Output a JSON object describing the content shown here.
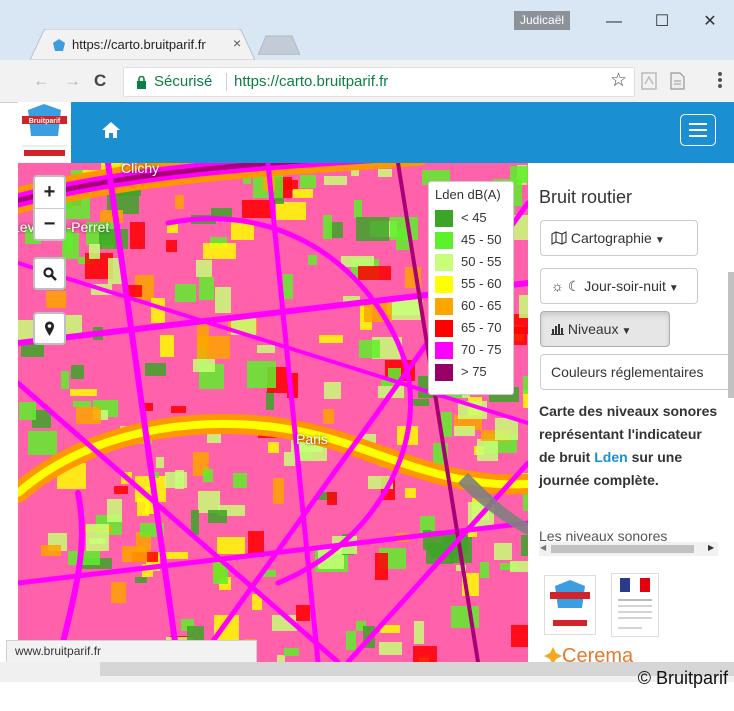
{
  "browser": {
    "tab_title": "https://carto.bruitparif.fr",
    "tab_close": "×",
    "user_name": "Judicaël",
    "window_controls": {
      "minimize": "—",
      "maximize": "☐",
      "close": "✕"
    },
    "nav": {
      "back": "←",
      "forward": "→",
      "reload": "C"
    },
    "address": {
      "secure_label": "Sécurisé",
      "url": "https://carto.bruitparif.fr"
    },
    "bookmark_star": "☆",
    "status_url": "www.bruitparif.fr"
  },
  "colors": {
    "header_blue": "#1a90d3",
    "chrome_tabstrip": "#d9e6f3",
    "secure_green": "#0b8043"
  },
  "map": {
    "controls": {
      "zoom_in": "+",
      "zoom_out": "−",
      "search_icon": "search-icon",
      "locate_icon": "map-marker-icon"
    },
    "place_labels": {
      "clichy": "Clichy",
      "levallois": "Levallois-Perret",
      "paris": "Paris"
    },
    "legend": {
      "title": "Lden dB(A)",
      "rows": [
        {
          "label": "< 45",
          "color": "#3ca528"
        },
        {
          "label": "45 - 50",
          "color": "#5ef02c"
        },
        {
          "label": "50 - 55",
          "color": "#c8ff78"
        },
        {
          "label": "55 - 60",
          "color": "#ffff00"
        },
        {
          "label": "60 - 65",
          "color": "#ffa500"
        },
        {
          "label": "65 - 70",
          "color": "#ff0000"
        },
        {
          "label": "70 - 75",
          "color": "#ff00ff"
        },
        {
          "label": "> 75",
          "color": "#990066"
        }
      ]
    }
  },
  "panel": {
    "title": "Bruit routier",
    "buttons": {
      "cartographie": "Cartographie",
      "periode": "Jour-soir-nuit",
      "niveaux": "Niveaux",
      "couleurs": "Couleurs réglementaires"
    },
    "description": {
      "before": "Carte des niveaux sonores représentant l'indicateur de bruit",
      "highlight": "Lden",
      "after": "sur une journée complète."
    },
    "more_text": "Les niveaux sonores",
    "partners": {
      "cerema": "Cerema"
    }
  },
  "copyright": "© Bruitparif"
}
